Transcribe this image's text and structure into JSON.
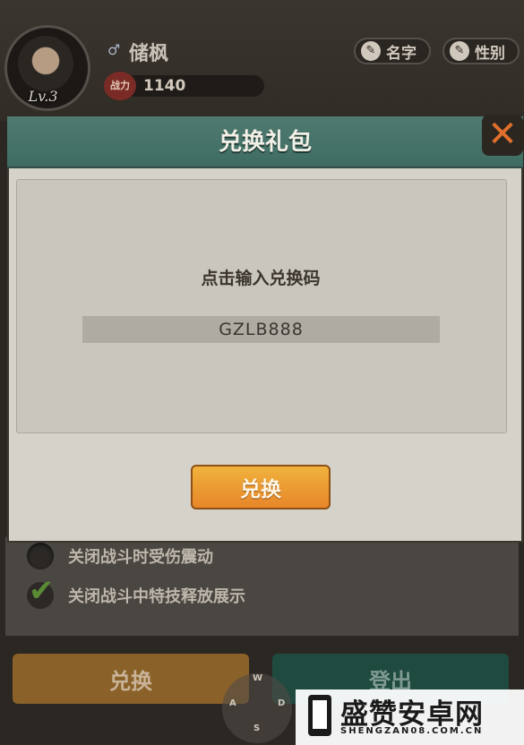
{
  "profile": {
    "level": "Lv.3",
    "gender_icon": "male-icon",
    "name": "储枫",
    "power_icon_label": "战力",
    "power_value": "1140",
    "name_button": "名字",
    "gender_button": "性别"
  },
  "dialog": {
    "title": "兑换礼包",
    "input_label": "点击输入兑换码",
    "code_value": "GZLB888",
    "redeem_button": "兑换",
    "close_icon": "close-icon"
  },
  "settings": {
    "option1": "关闭战斗时受伤震动",
    "option1_checked": false,
    "option2": "关闭战斗中特技释放展示",
    "option2_checked": true
  },
  "bottom": {
    "redeem_button": "兑换",
    "logout_button": "登出"
  },
  "keys": {
    "w": "W",
    "a": "A",
    "s": "S",
    "d": "D"
  },
  "watermark": {
    "title": "盛赞安卓网",
    "url": "SHENGZAN08.COM.CN"
  },
  "colors": {
    "accent_orange": "#e7862a",
    "header_teal": "#3e6c63",
    "close_orange": "#e0702c",
    "check_green": "#5a8a34"
  }
}
